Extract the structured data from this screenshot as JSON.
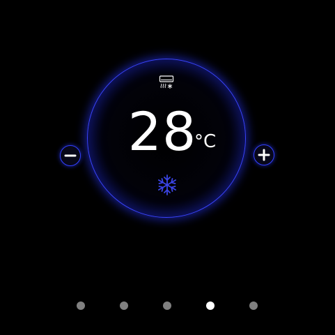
{
  "thermostat": {
    "mode": "cooling",
    "mode_icon": "ac-unit-icon",
    "temperature": "28",
    "unit": "°C",
    "status_icon": "snowflake-icon",
    "minus_icon": "minus-icon",
    "plus_icon": "plus-icon"
  },
  "pager": {
    "page_count": 5,
    "active_page": 4
  },
  "colors": {
    "background": "#000000",
    "accent_blue": "#3a44ff",
    "snowflake_blue": "#3b45e6",
    "text": "#ffffff",
    "dot_inactive": "#808080",
    "dot_active": "#ffffff"
  }
}
